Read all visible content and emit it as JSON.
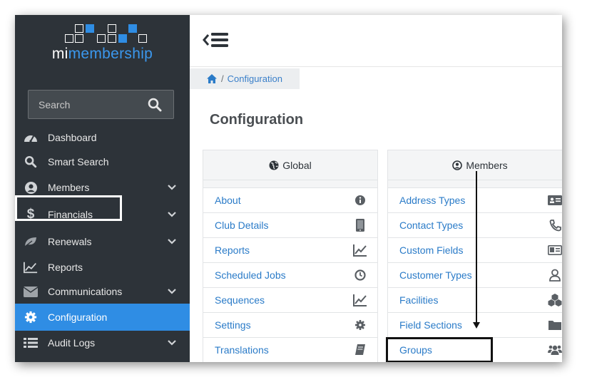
{
  "app": {
    "logo_prefix": "mi",
    "logo_suffix": "membership"
  },
  "search": {
    "placeholder": "Search"
  },
  "sidebar": {
    "items": [
      {
        "label": "Dashboard",
        "icon": "dashboard-icon",
        "expandable": false
      },
      {
        "label": "Smart Search",
        "icon": "search-icon",
        "expandable": false
      },
      {
        "label": "Members",
        "icon": "user-circle-icon",
        "expandable": true
      },
      {
        "label": "Financials",
        "icon": "dollar-icon",
        "expandable": true
      },
      {
        "label": "Renewals",
        "icon": "leaf-icon",
        "expandable": true
      },
      {
        "label": "Reports",
        "icon": "line-chart-icon",
        "expandable": false
      },
      {
        "label": "Communications",
        "icon": "envelope-icon",
        "expandable": true
      },
      {
        "label": "Configuration",
        "icon": "gear-icon",
        "expandable": false,
        "active": true
      },
      {
        "label": "Audit Logs",
        "icon": "list-icon",
        "expandable": true
      }
    ]
  },
  "breadcrumb": {
    "separator": "/",
    "current": "Configuration"
  },
  "page": {
    "title": "Configuration"
  },
  "global_panel": {
    "title": "Global",
    "items": [
      {
        "label": "About",
        "icon": "info-icon"
      },
      {
        "label": "Club Details",
        "icon": "tablet-icon"
      },
      {
        "label": "Reports",
        "icon": "line-chart-icon"
      },
      {
        "label": "Scheduled Jobs",
        "icon": "clock-icon"
      },
      {
        "label": "Sequences",
        "icon": "line-chart-icon"
      },
      {
        "label": "Settings",
        "icon": "gear-icon"
      },
      {
        "label": "Translations",
        "icon": "book-icon"
      }
    ]
  },
  "members_panel": {
    "title": "Members",
    "items": [
      {
        "label": "Address Types",
        "icon": "address-card-icon"
      },
      {
        "label": "Contact Types",
        "icon": "phone-icon"
      },
      {
        "label": "Custom Fields",
        "icon": "id-card-icon"
      },
      {
        "label": "Customer Types",
        "icon": "user-icon"
      },
      {
        "label": "Facilities",
        "icon": "cubes-icon"
      },
      {
        "label": "Field Sections",
        "icon": "folder-icon"
      },
      {
        "label": "Groups",
        "icon": "users-icon"
      }
    ]
  },
  "colors": {
    "sidebar_bg": "#2d3339",
    "accent": "#2f8de4",
    "link": "#2a7bc8"
  }
}
